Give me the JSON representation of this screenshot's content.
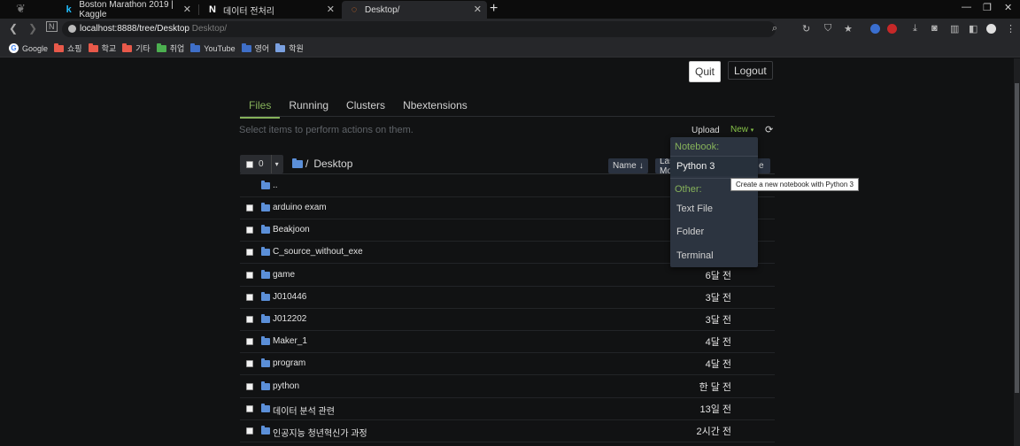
{
  "browser": {
    "tabs": [
      {
        "title": "Boston Marathon 2019 | Kaggle",
        "icon": "kaggle-icon"
      },
      {
        "title": "데이터 전처리",
        "icon": "notion-icon"
      },
      {
        "title": "Desktop/",
        "icon": "jupyter-icon"
      }
    ],
    "address": {
      "url": "localhost:8888/tree/Desktop",
      "url_suffix": "Desktop/"
    },
    "bookmarks": [
      {
        "label": "Google",
        "color": "#ffffff"
      },
      {
        "label": "쇼핑",
        "color": "#e8594a"
      },
      {
        "label": "학교",
        "color": "#e8594a"
      },
      {
        "label": "기타",
        "color": "#e8594a"
      },
      {
        "label": "취업",
        "color": "#4caf50"
      },
      {
        "label": "YouTube",
        "color": "#e53935"
      },
      {
        "label": "영어",
        "color": "#3f6fc8"
      },
      {
        "label": "학원",
        "color": "#7aa0e0"
      }
    ]
  },
  "page": {
    "quit_label": "Quit",
    "logout_label": "Logout",
    "nav_tabs": [
      "Files",
      "Running",
      "Clusters",
      "Nbextensions"
    ],
    "hint": "Select items to perform actions on them.",
    "upload_label": "Upload",
    "new_label": "New",
    "selected_count": "0",
    "breadcrumb": "Desktop",
    "sort_name": "Name",
    "sort_last": "Last Modified",
    "sort_size_fragment": "e",
    "parent_dir": "..",
    "files": [
      {
        "name": "arduino exam",
        "time": ""
      },
      {
        "name": "Beakjoon",
        "time": ""
      },
      {
        "name": "C_source_without_exe",
        "time": ""
      },
      {
        "name": "game",
        "time": "6달 전"
      },
      {
        "name": "J010446",
        "time": "3달 전"
      },
      {
        "name": "J012202",
        "time": "3달 전"
      },
      {
        "name": "Maker_1",
        "time": "4달 전"
      },
      {
        "name": "program",
        "time": "4달 전"
      },
      {
        "name": "python",
        "time": "한 달 전"
      },
      {
        "name": "데이터 분석 관련",
        "time": "13일 전"
      },
      {
        "name": "인공지능 청년혁신가 과정",
        "time": "2시간 전"
      }
    ],
    "new_menu": {
      "notebook_header": "Notebook:",
      "python3": "Python 3",
      "other_header": "Other:",
      "text_file": "Text File",
      "folder": "Folder",
      "terminal": "Terminal"
    },
    "tooltip": "Create a new notebook with Python 3"
  },
  "colors": {
    "accent_green": "#86b25a",
    "folder_blue": "#5b8fd8",
    "background": "#111213"
  }
}
